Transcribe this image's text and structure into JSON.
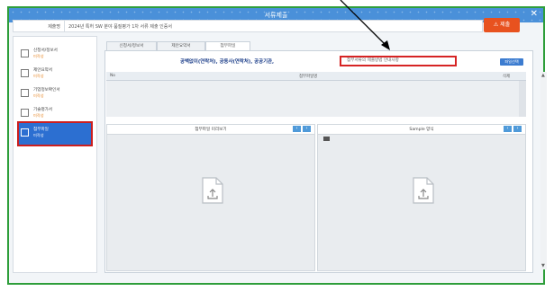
{
  "window": {
    "title": "서류제출",
    "close_glyph": "✕"
  },
  "request_row": {
    "label": "제출명",
    "value": "2024년 특허 SW 분야 품질평가 1차 서류 제출 인증서"
  },
  "submit_button": {
    "label": "⚠ 제출",
    "color": "#e8521f"
  },
  "sidebar": {
    "items": [
      {
        "name": "신청서/정보서",
        "status": "미작성",
        "icon": "document-icon"
      },
      {
        "name": "제안요약서",
        "status": "미작성",
        "icon": "checklist-icon"
      },
      {
        "name": "기업정보확인서",
        "status": "미작성",
        "icon": "form-icon"
      },
      {
        "name": "기술평가서",
        "status": "미작성",
        "icon": "grid-icon"
      },
      {
        "name": "첨부파일",
        "status": "미작성",
        "icon": "attachment-icon"
      }
    ]
  },
  "tabs": [
    "신청서/정보서",
    "제안요약서",
    "첨부파일"
  ],
  "notice": {
    "main": "공백없이(연락처), 공동사(연락처), 공공기관,",
    "highlight": "첨부서류의 제출방법 안내사항"
  },
  "add_button": {
    "label": "파일선택"
  },
  "table": {
    "columns": [
      "No",
      "첨부파일명",
      "삭제"
    ]
  },
  "panels": [
    {
      "title": "첨부파일 미리보기"
    },
    {
      "title": "Sample 양식"
    }
  ],
  "colors": {
    "accent": "#2c6fd1",
    "frame": "#2e9e3a",
    "highlight_border": "#d62424"
  }
}
